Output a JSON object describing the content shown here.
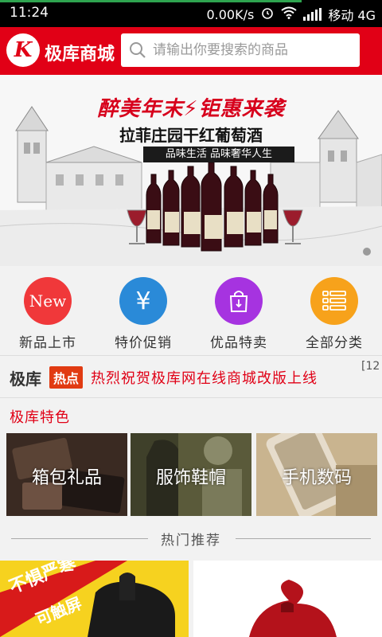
{
  "status_bar": {
    "time": "11:24",
    "network_speed": "0.00K/s",
    "carrier": "移动 4G",
    "load_progress": 0.79
  },
  "header": {
    "logo_letter": "K",
    "brand": "极库商城",
    "search_placeholder": "请输出你要搜索的商品"
  },
  "banner": {
    "headline": "醉美年末⚡钜惠来袭",
    "subhead": "拉菲庄园干红葡萄酒",
    "tagline": "品味生活 品味奢华人生"
  },
  "quick_nav": [
    {
      "label": "新品上市",
      "icon": "new-icon",
      "icon_text": "New",
      "color": "#f0383a"
    },
    {
      "label": "特价促销",
      "icon": "yen-icon",
      "icon_text": "¥",
      "color": "#2a8ad8"
    },
    {
      "label": "优品特卖",
      "icon": "shopping-bag-icon",
      "icon_text": "",
      "color": "#a633e0"
    },
    {
      "label": "全部分类",
      "icon": "list-icon",
      "icon_text": "",
      "color": "#f7a21b"
    }
  ],
  "news": {
    "brand": "极库",
    "tag": "热点",
    "text": "热烈祝贺极库网在线商城改版上线",
    "extra": "[12"
  },
  "featured": {
    "title": "极库特色",
    "items": [
      {
        "label": "箱包礼品"
      },
      {
        "label": "服饰鞋帽"
      },
      {
        "label": "手机数码"
      }
    ]
  },
  "hot": {
    "title": "热门推荐",
    "promo_text_1": "不惧严寒",
    "promo_text_2": "可触屏"
  },
  "colors": {
    "brand_red": "#e10016",
    "accent_orange": "#e13b12"
  }
}
